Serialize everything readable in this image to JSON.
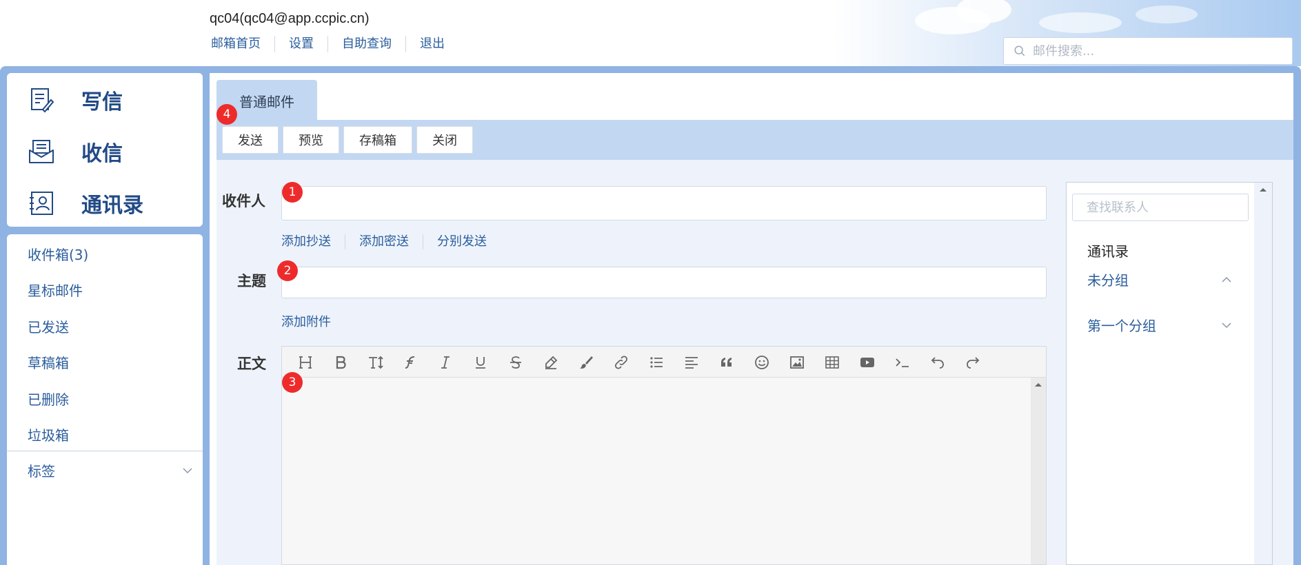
{
  "header": {
    "account": "qc04(qc04@app.ccpic.cn)",
    "nav": [
      "邮箱首页",
      "设置",
      "自助查询",
      "退出"
    ],
    "search_placeholder": "邮件搜索..."
  },
  "sidebar": {
    "actions": [
      {
        "label": "写信",
        "icon": "compose-icon"
      },
      {
        "label": "收信",
        "icon": "inbox-tray-icon"
      },
      {
        "label": "通讯录",
        "icon": "contacts-icon"
      }
    ],
    "folders": [
      "收件箱(3)",
      "星标邮件",
      "已发送",
      "草稿箱",
      "已删除",
      "垃圾箱"
    ],
    "tags_label": "标签"
  },
  "compose": {
    "tab": "普通邮件",
    "toolbar": {
      "send": "发送",
      "preview": "预览",
      "draft": "存稿箱",
      "close": "关闭"
    },
    "recipient_label": "收件人",
    "recipient_links": [
      "添加抄送",
      "添加密送",
      "分别发送"
    ],
    "subject_label": "主题",
    "attachment_link": "添加附件",
    "body_label": "正文",
    "editor_tools": [
      "heading-icon",
      "bold-icon",
      "font-size-icon",
      "font-family-icon",
      "italic-icon",
      "underline-icon",
      "strikethrough-icon",
      "highlight-icon",
      "color-brush-icon",
      "link-icon",
      "bullet-list-icon",
      "align-icon",
      "quote-icon",
      "emoji-icon",
      "image-icon",
      "table-icon",
      "video-icon",
      "code-icon",
      "undo-icon",
      "redo-icon"
    ]
  },
  "badges": [
    "1",
    "2",
    "3",
    "4"
  ],
  "contacts": {
    "search_placeholder": "查找联系人",
    "title": "通讯录",
    "groups": [
      {
        "name": "未分组",
        "state": "expanded"
      },
      {
        "name": "第一个分组",
        "state": "collapsed"
      }
    ]
  },
  "colors": {
    "accent": "#2a5d9c",
    "frame": "#8fb3e2",
    "toolbar": "#c2d7f1",
    "badge": "#ee2b2b",
    "form_bg": "#eef3fb"
  }
}
